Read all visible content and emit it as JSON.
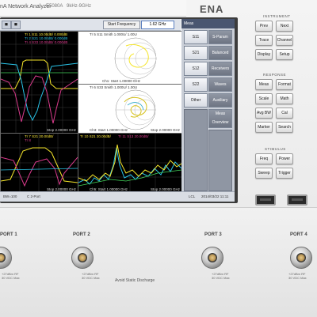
{
  "header": {
    "brand": "nA Network Analyzer",
    "model": "E5080A",
    "freq_range": "9kHz-9GHz",
    "ena": "ENA"
  },
  "toolbar": {
    "btn1": "◼",
    "btn2": "◼",
    "sf_label": "Start Frequency",
    "sf_value": "1.62 GHz"
  },
  "traces": {
    "tr1": {
      "head1": "Tr 1  S11 10.00dB/ 0.000dB",
      "head2": "Tr 2  S21 10.00dB/ 0.000dB",
      "head3": "Tr 4  S33 10.00dB/ 0.000dB",
      "foot": "Ch1: Start  1.00000 GHz",
      "stop": "Stop  2.00000 GHz"
    },
    "tr5": {
      "head": "Tr 5  S11 Smith 1.000U/ 1.00U",
      "foot": "Ch1: Start  1.00000 GHz",
      "stop": "Stop  1.00000 GHz"
    },
    "tr6": {
      "head": "Tr 6  S33 Smith 1.000U/ 1.00U",
      "foot": "Ch3: Start  1.00000 GHz",
      "stop": "Stop  2.00000 GHz"
    },
    "tr7": {
      "head1": "Tr 7  S21 20.00dB/",
      "head2": "Tr 8",
      "foot": "",
      "stop": "Stop  2.00000 GHz"
    },
    "tr9": {
      "head1": "Tr 10  S21 20.00dB/",
      "head2": "Tr 11  S13 20.00dB/",
      "foot": "Ch5: Start  1.00000 GHz",
      "stop": "Stop  2.00000 GHz"
    }
  },
  "softkeys": {
    "title": "Meas",
    "s11": "S11",
    "s21": "S21",
    "s12": "S12",
    "s22": "S22",
    "other": "Other",
    "right1": "S-Param",
    "right2": "Balanced",
    "right3": "Receivers",
    "right4": "Waves",
    "right5": "Auxiliary",
    "right6": "Meas Overview"
  },
  "statusbar": {
    "left": "BW=100",
    "mid": "C  2-Port",
    "right1": "LCL",
    "right2": "2014/03/22 11:11"
  },
  "side_panel": {
    "instrument_title": "INSTRUMENT",
    "response_title": "RESPONSE",
    "stimulus_title": "STIMULUS",
    "instr_keys": [
      "Prev",
      "Next",
      "Trace",
      "Channel",
      "Display",
      "Setup"
    ],
    "resp_keys": [
      "Meas",
      "Format",
      "Scale",
      "Math",
      "Avg BW",
      "Cal",
      "Marker",
      "Search"
    ],
    "stim_keys": [
      "Freq",
      "Power",
      "Sweep",
      "Trigger"
    ]
  },
  "ports": {
    "p1": "PORT 1",
    "p2": "PORT 2",
    "p3": "PORT 3",
    "p4": "PORT 4",
    "warn1": "+27dBm RF",
    "warn2": "30 VDC Max",
    "esd": "Avoid Static Discharge"
  },
  "colors": {
    "trace_yellow": "#f5e52a",
    "trace_cyan": "#29c2e6",
    "trace_magenta": "#d93a8b",
    "trace_green": "#43d35a",
    "softkey_header": "#4a5670"
  }
}
